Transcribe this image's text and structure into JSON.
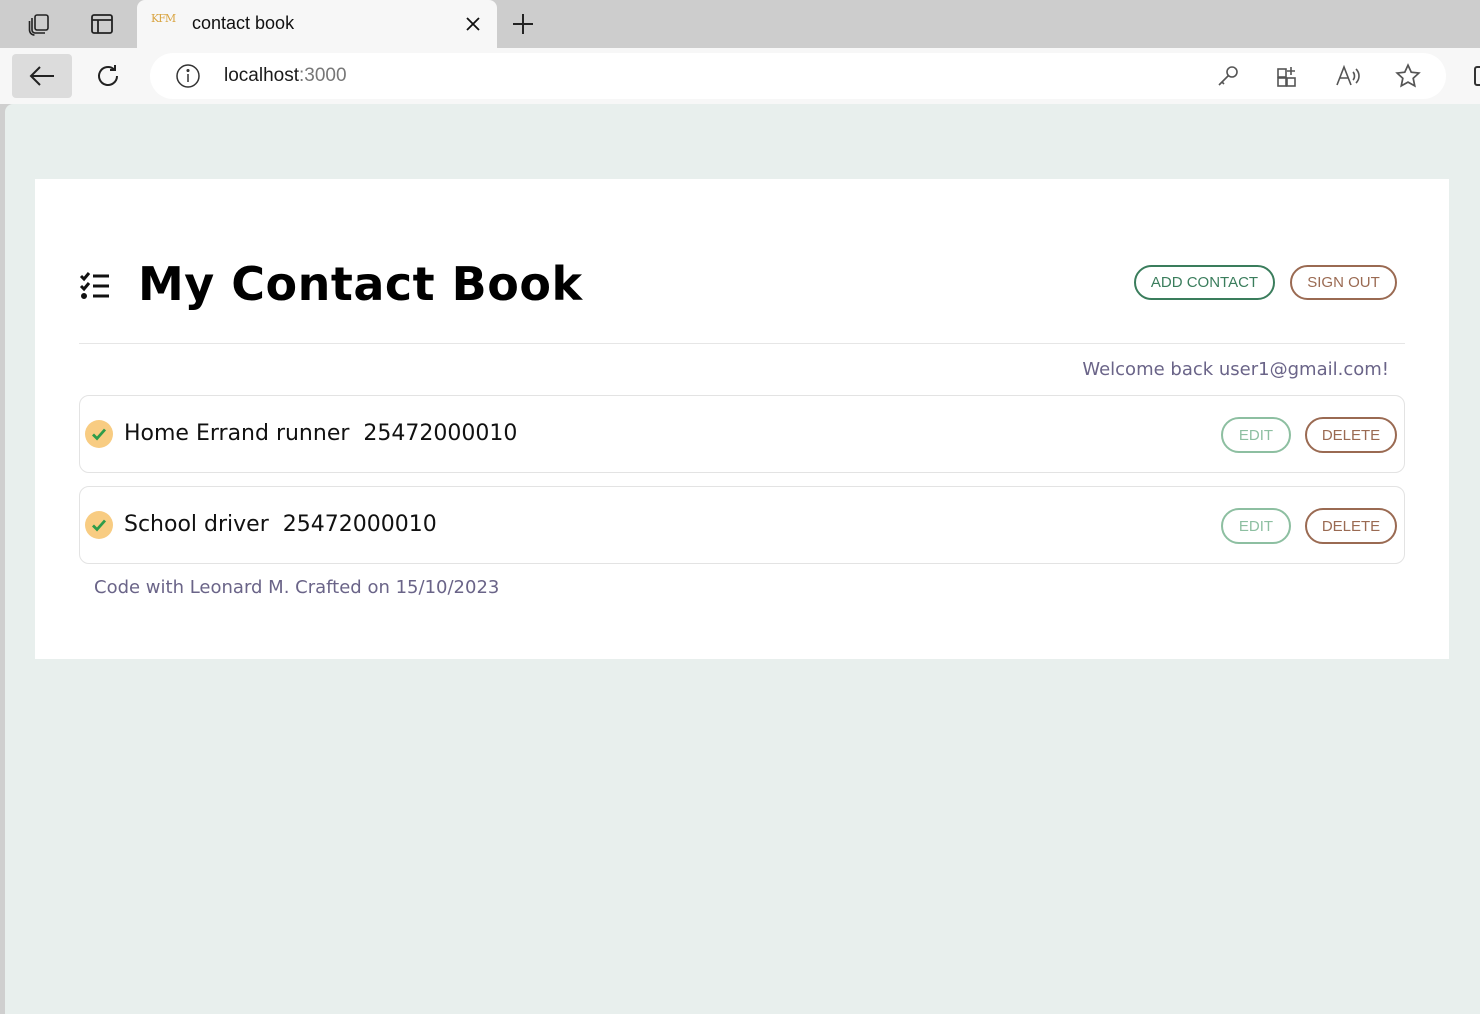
{
  "browser": {
    "tab_title": "contact book",
    "favicon_text": "KFM",
    "url_host": "localhost",
    "url_port": ":3000"
  },
  "page": {
    "title": "My Contact Book",
    "add_contact_label": "ADD CONTACT",
    "sign_out_label": "SIGN OUT",
    "welcome_text": "Welcome back user1@gmail.com!",
    "footer_text": "Code with Leonard M. Crafted on 15/10/2023"
  },
  "contacts": [
    {
      "name": "Home Errand runner",
      "phone": "25472000010",
      "display": "Home Errand runner  25472000010",
      "edit_label": "EDIT",
      "delete_label": "DELETE"
    },
    {
      "name": "School driver",
      "phone": "25472000010",
      "display": "School driver  25472000010",
      "edit_label": "EDIT",
      "delete_label": "DELETE"
    }
  ],
  "colors": {
    "background": "#e8efed",
    "add_button": "#3a7d5c",
    "delete_button": "#9a6a52",
    "edit_button": "#8dbfa1",
    "check_badge": "#f8cc82",
    "check_mark": "#2e9c4a",
    "muted_text": "#6a6488"
  },
  "icons": [
    "workspaces-icon",
    "tab-actions-icon",
    "close-icon",
    "plus-icon",
    "back-arrow-icon",
    "reload-icon",
    "info-icon",
    "key-icon",
    "apps-icon",
    "read-aloud-icon",
    "favorite-star-icon",
    "checklist-icon",
    "check-icon"
  ]
}
